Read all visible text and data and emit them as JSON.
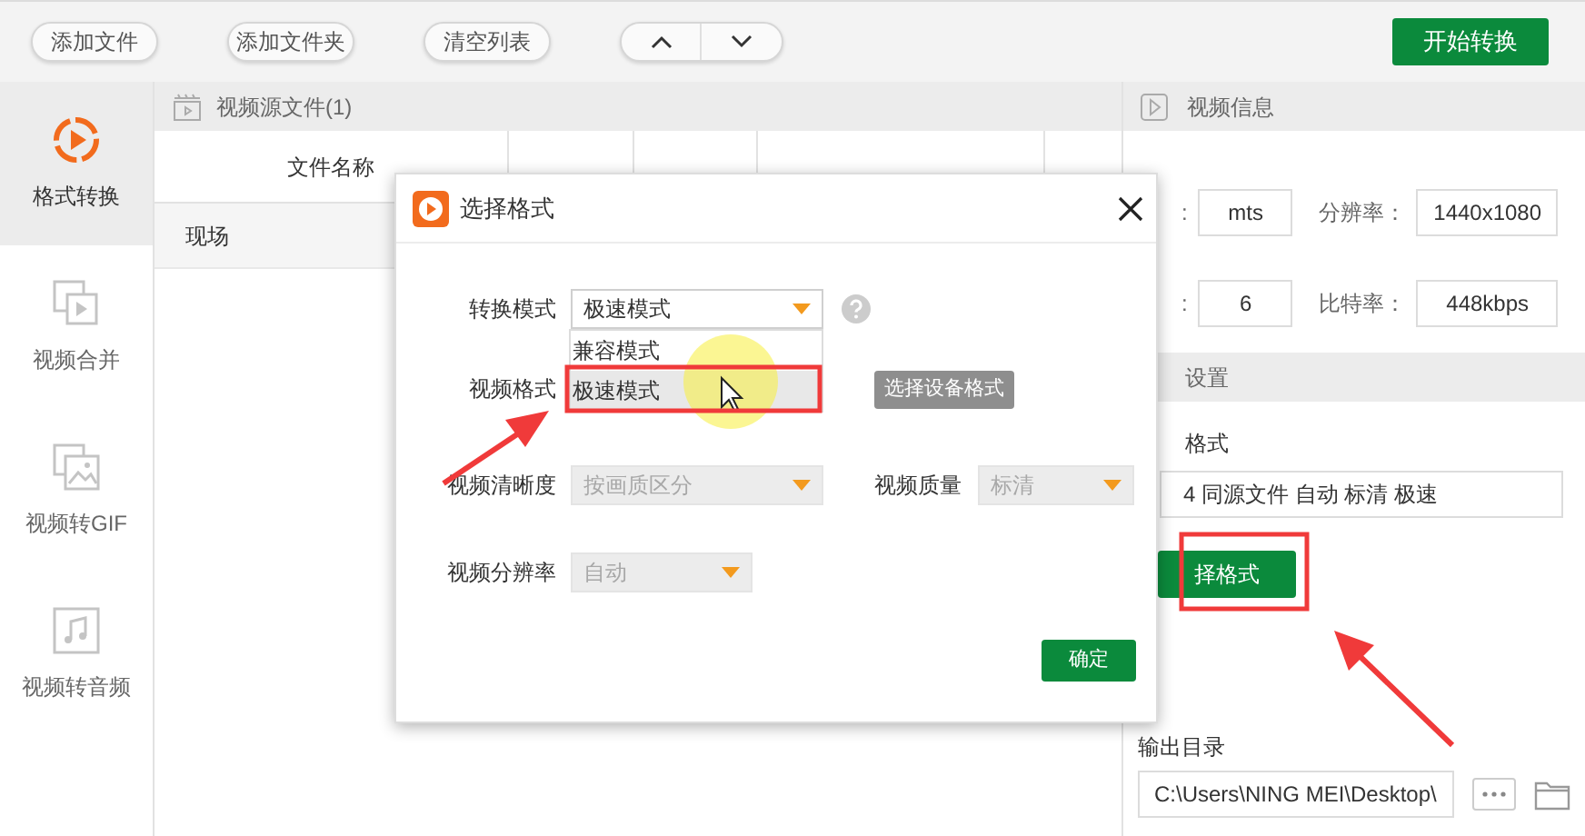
{
  "toolbar": {
    "buttons": [
      {
        "label": "添加文件"
      },
      {
        "label": "添加文件夹"
      },
      {
        "label": "清空列表"
      }
    ],
    "start_button": "开始转换"
  },
  "sidebar": {
    "items": [
      {
        "label": "格式转换",
        "selected": true
      },
      {
        "label": "视频合并",
        "selected": false
      },
      {
        "label": "视频转GIF",
        "selected": false
      },
      {
        "label": "视频转音频",
        "selected": false
      }
    ]
  },
  "file_panel": {
    "title": "视频源文件(1)",
    "columns": [
      "文件名称"
    ],
    "rows": [
      {
        "cells": [
          "现场"
        ]
      }
    ]
  },
  "video_info": {
    "title": "视频信息",
    "fields": [
      {
        "label": ":",
        "value": "mts"
      },
      {
        "label": "分辨率：",
        "value": "1440x1080"
      },
      {
        "label": ":",
        "value": "6"
      },
      {
        "label": "比特率：",
        "value": "448kbps"
      }
    ]
  },
  "output_settings": {
    "title": "设置",
    "format_label": "格式",
    "format_value": "4 同源文件 自动 标清 极速",
    "choose_button": "择格式",
    "output_label": "输出目录",
    "output_path": "C:\\Users\\NING MEI\\Desktop\\"
  },
  "dialog": {
    "title": "选择格式",
    "mode": {
      "label": "转换模式",
      "value": "极速模式",
      "disabled": false
    },
    "mode_options": [
      {
        "label": "兼容模式",
        "selected": false
      },
      {
        "label": "极速模式",
        "selected": true
      }
    ],
    "format_label": "视频格式",
    "device_button": "选择设备格式",
    "clarity": {
      "label": "视频清晰度",
      "value": "按画质区分",
      "disabled": true
    },
    "quality": {
      "label": "视频质量",
      "value": "标清",
      "disabled": true
    },
    "resolution": {
      "label": "视频分辨率",
      "value": "自动",
      "disabled": true
    },
    "ok_button": "确定"
  }
}
